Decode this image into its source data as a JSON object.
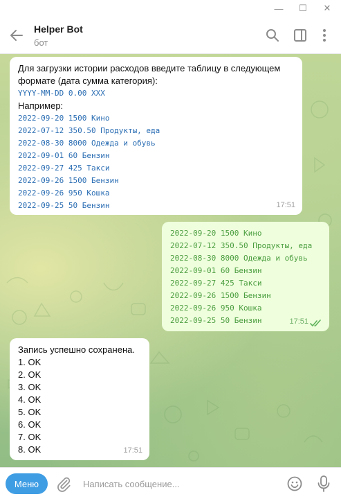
{
  "window": {
    "minimize": "—",
    "maximize": "☐",
    "close": "✕"
  },
  "header": {
    "title": "Helper Bot",
    "subtitle": "бот"
  },
  "messages": [
    {
      "intro": "Для загрузки истории расходов введите таблицу в следующем формате (дата сумма категория):",
      "format": "YYYY-MM-DD 0.00 XXX",
      "example_label": "Например:",
      "lines": [
        "2022-09-20 1500 Кино",
        "2022-07-12 350.50 Продукты, еда",
        "2022-08-30 8000 Одежда и обувь",
        "2022-09-01 60 Бензин",
        "2022-09-27 425 Такси",
        "2022-09-26 1500 Бензин",
        "2022-09-26 950 Кошка",
        "2022-09-25 50 Бензин"
      ],
      "time": "17:51"
    },
    {
      "lines": [
        "2022-09-20 1500 Кино",
        "2022-07-12 350.50 Продукты, еда",
        "2022-08-30 8000 Одежда и обувь",
        "2022-09-01 60 Бензин",
        "2022-09-27 425 Такси",
        "2022-09-26 1500 Бензин",
        "2022-09-26 950 Кошка",
        "2022-09-25 50 Бензин"
      ],
      "time": "17:51"
    },
    {
      "heading": "Запись успешно сохранена.",
      "lines": [
        "1. OK",
        "2. OK",
        "3. OK",
        "4. OK",
        "5. OK",
        "6. OK",
        "7. OK",
        "8. OK"
      ],
      "time": "17:51"
    }
  ],
  "composer": {
    "menu_label": "Меню",
    "placeholder": "Написать сообщение..."
  }
}
